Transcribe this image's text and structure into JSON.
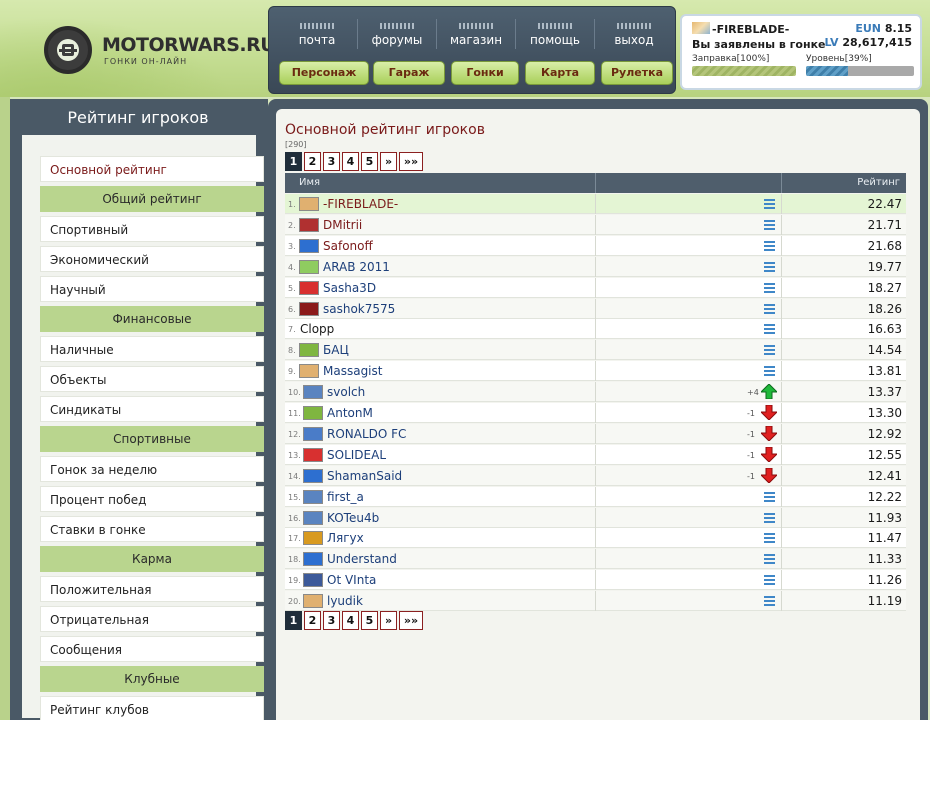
{
  "site": {
    "logo_text": "MOTORWARS.RU",
    "logo_sub": "ГОНКИ ОН-ЛАЙН"
  },
  "nav": {
    "top": [
      "почта",
      "форумы",
      "магазин",
      "помощь",
      "выход"
    ],
    "buttons": [
      "Персонаж",
      "Гараж",
      "Гонки",
      "Карта",
      "Рулетка"
    ]
  },
  "user": {
    "name": "-FIREBLADE-",
    "status": "Вы заявлены в гонке",
    "currency_label": "EUN",
    "currency_value": "8.15",
    "lv_label": "LV",
    "lv_value": "28,617,415",
    "fuel_label": "Заправка[100%]",
    "fuel_percent": 100,
    "level_label": "Уровень[39%]",
    "level_percent": 39
  },
  "sidebar": {
    "title": "Рейтинг игроков",
    "items": [
      {
        "type": "item",
        "label": "Основной рейтинг",
        "active": true
      },
      {
        "type": "head",
        "label": "Общий рейтинг"
      },
      {
        "type": "item",
        "label": "Спортивный"
      },
      {
        "type": "item",
        "label": "Экономический"
      },
      {
        "type": "item",
        "label": "Научный"
      },
      {
        "type": "head",
        "label": "Финансовые"
      },
      {
        "type": "item",
        "label": "Наличные"
      },
      {
        "type": "item",
        "label": "Объекты"
      },
      {
        "type": "item",
        "label": "Синдикаты"
      },
      {
        "type": "head",
        "label": "Спортивные"
      },
      {
        "type": "item",
        "label": "Гонок за неделю"
      },
      {
        "type": "item",
        "label": "Процент побед"
      },
      {
        "type": "item",
        "label": "Ставки в гонке"
      },
      {
        "type": "head",
        "label": "Карма"
      },
      {
        "type": "item",
        "label": "Положительная"
      },
      {
        "type": "item",
        "label": "Отрицательная"
      },
      {
        "type": "item",
        "label": "Сообщения"
      },
      {
        "type": "head",
        "label": "Клубные"
      },
      {
        "type": "item",
        "label": "Рейтинг клубов"
      }
    ]
  },
  "main": {
    "title": "Основной рейтинг игроков",
    "count": "[290]",
    "pager": [
      "1",
      "2",
      "3",
      "4",
      "5",
      "»",
      "»»"
    ],
    "current_page": "1",
    "col_name": "Имя",
    "col_rating": "Рейтинг",
    "rows": [
      {
        "rank": "1.",
        "name": "-FIREBLADE-",
        "score": "22.47",
        "trend": "same",
        "delta": "",
        "flag": "#e0b070",
        "color": "red",
        "me": true
      },
      {
        "rank": "2.",
        "name": "DMitrii",
        "score": "21.71",
        "trend": "same",
        "delta": "",
        "flag": "#b03030",
        "color": "red"
      },
      {
        "rank": "3.",
        "name": "Safonoff",
        "score": "21.68",
        "trend": "same",
        "delta": "",
        "flag": "#2d6fd0",
        "color": "red"
      },
      {
        "rank": "4.",
        "name": "ARAB 2011",
        "score": "19.77",
        "trend": "same",
        "delta": "",
        "flag": "#8fcc60",
        "color": "blue"
      },
      {
        "rank": "5.",
        "name": "Sasha3D",
        "score": "18.27",
        "trend": "same",
        "delta": "",
        "flag": "#d83030",
        "color": "blue"
      },
      {
        "rank": "6.",
        "name": "sashok7575",
        "score": "18.26",
        "trend": "same",
        "delta": "",
        "flag": "#8b1a1a",
        "color": "blue"
      },
      {
        "rank": "7.",
        "name": "Clopp",
        "score": "16.63",
        "trend": "same",
        "delta": "",
        "flag": "",
        "color": "blue"
      },
      {
        "rank": "8.",
        "name": "БАЦ",
        "score": "14.54",
        "trend": "same",
        "delta": "",
        "flag": "#7fb640",
        "color": "blue"
      },
      {
        "rank": "9.",
        "name": "Massagist",
        "score": "13.81",
        "trend": "same",
        "delta": "",
        "flag": "#e0b070",
        "color": "blue"
      },
      {
        "rank": "10.",
        "name": "svolch",
        "score": "13.37",
        "trend": "up",
        "delta": "+4",
        "flag": "#5a84c0",
        "color": "blue"
      },
      {
        "rank": "11.",
        "name": "AntonM",
        "score": "13.30",
        "trend": "down",
        "delta": "-1",
        "flag": "#7fb640",
        "color": "blue"
      },
      {
        "rank": "12.",
        "name": "RONALDO FC",
        "score": "12.92",
        "trend": "down",
        "delta": "-1",
        "flag": "#4a7cc8",
        "color": "blue"
      },
      {
        "rank": "13.",
        "name": "SOLIDEAL",
        "score": "12.55",
        "trend": "down",
        "delta": "-1",
        "flag": "#d83030",
        "color": "blue"
      },
      {
        "rank": "14.",
        "name": "ShamanSaid",
        "score": "12.41",
        "trend": "down",
        "delta": "-1",
        "flag": "#2d6fd0",
        "color": "blue"
      },
      {
        "rank": "15.",
        "name": "first_a",
        "score": "12.22",
        "trend": "same",
        "delta": "",
        "flag": "#5a84c0",
        "color": "blue"
      },
      {
        "rank": "16.",
        "name": "KOTeu4b",
        "score": "11.93",
        "trend": "same",
        "delta": "",
        "flag": "#5a84c0",
        "color": "blue"
      },
      {
        "rank": "17.",
        "name": "Лягух",
        "score": "11.47",
        "trend": "same",
        "delta": "",
        "flag": "#d89a20",
        "color": "blue"
      },
      {
        "rank": "18.",
        "name": "Understand",
        "score": "11.33",
        "trend": "same",
        "delta": "",
        "flag": "#2d6fd0",
        "color": "blue"
      },
      {
        "rank": "19.",
        "name": "Ot VInta",
        "score": "11.26",
        "trend": "same",
        "delta": "",
        "flag": "#3d5a9a",
        "color": "blue"
      },
      {
        "rank": "20.",
        "name": "lyudik",
        "score": "11.19",
        "trend": "same",
        "delta": "",
        "flag": "#e0b070",
        "color": "blue"
      }
    ]
  }
}
